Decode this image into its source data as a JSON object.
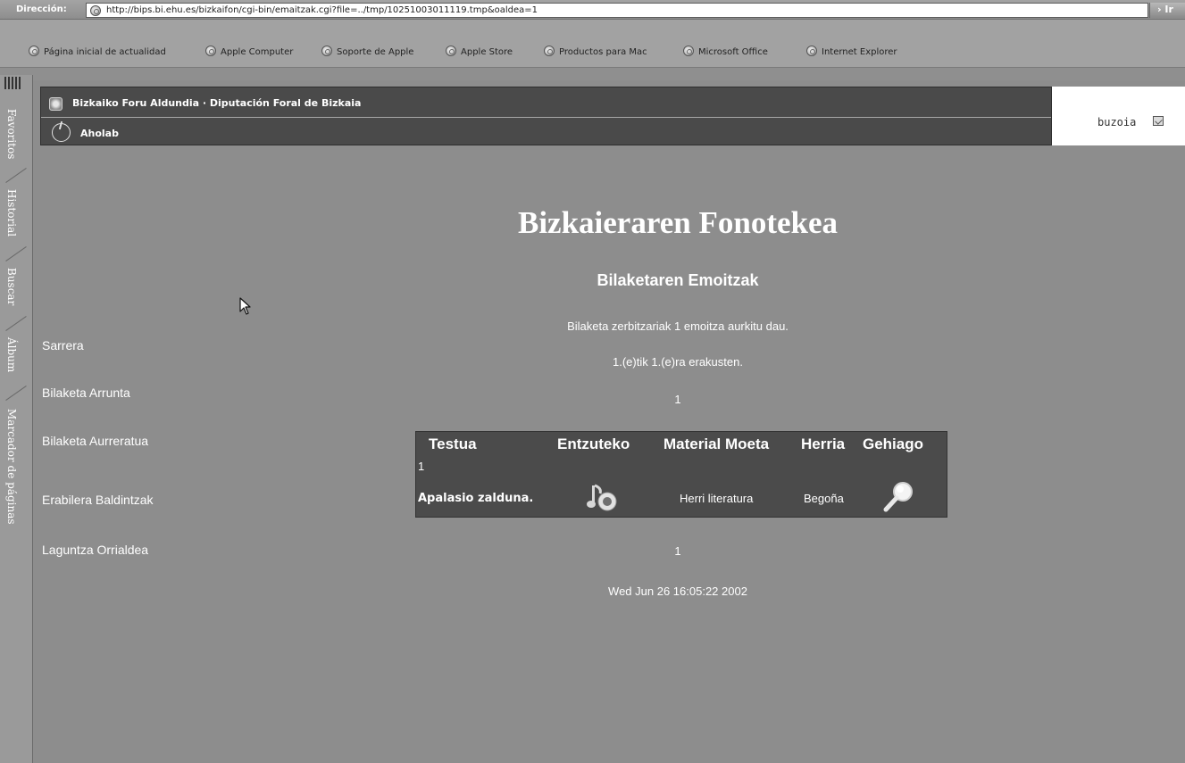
{
  "browser": {
    "address_label": "Dirección:",
    "url": "http://bips.bi.ehu.es/bizkaifon/cgi-bin/emaitzak.cgi?file=../tmp/10251003011119.tmp&oaldea=1",
    "go_label": "› Ir",
    "favorites": [
      "Página inicial de actualidad",
      "Apple Computer",
      "Soporte de Apple",
      "Apple Store",
      "Productos para Mac",
      "Microsoft Office",
      "Internet Explorer"
    ],
    "side_tabs": [
      "Favoritos",
      "Historial",
      "Buscar",
      "Álbum",
      "Marcador de páginas"
    ]
  },
  "header": {
    "agency_title": "Bizkaiko Foru Aldundia · Diputación Foral de Bizkaia",
    "lab_label": "Aholab",
    "mailbox_label": "buzoia"
  },
  "nav": {
    "items": [
      "Sarrera",
      "Bilaketa Arrunta",
      "Bilaketa Aurreratua",
      "Erabilera Baldintzak",
      "Laguntza Orrialdea"
    ]
  },
  "main": {
    "title": "Bizkaieraren Fonotekea",
    "subtitle": "Bilaketaren Emoitzak",
    "result_summary": "Bilaketa zerbitzariak 1 emoitza aurkitu dau.",
    "showing": "1.(e)tik 1.(e)ra erakusten.",
    "page_top": "1",
    "page_bottom": "1",
    "timestamp": "Wed Jun 26 16:05:22 2002"
  },
  "table": {
    "headers": {
      "text": "Testua",
      "listen": "Entzuteko",
      "material": "Material Moeta",
      "town": "Herria",
      "more": "Gehiago"
    },
    "rows": [
      {
        "num": "1",
        "title": "Apalasio zalduna.",
        "listen_icon": "music-note-icon",
        "material": "Herri literatura",
        "town": "Begoña",
        "more_icon": "magnifier-icon"
      }
    ]
  },
  "colors": {
    "page_bg": "#8d8d8d",
    "header_bar": "#4a4a4a",
    "table_bg": "#4b4b4b",
    "text": "#ffffff"
  }
}
